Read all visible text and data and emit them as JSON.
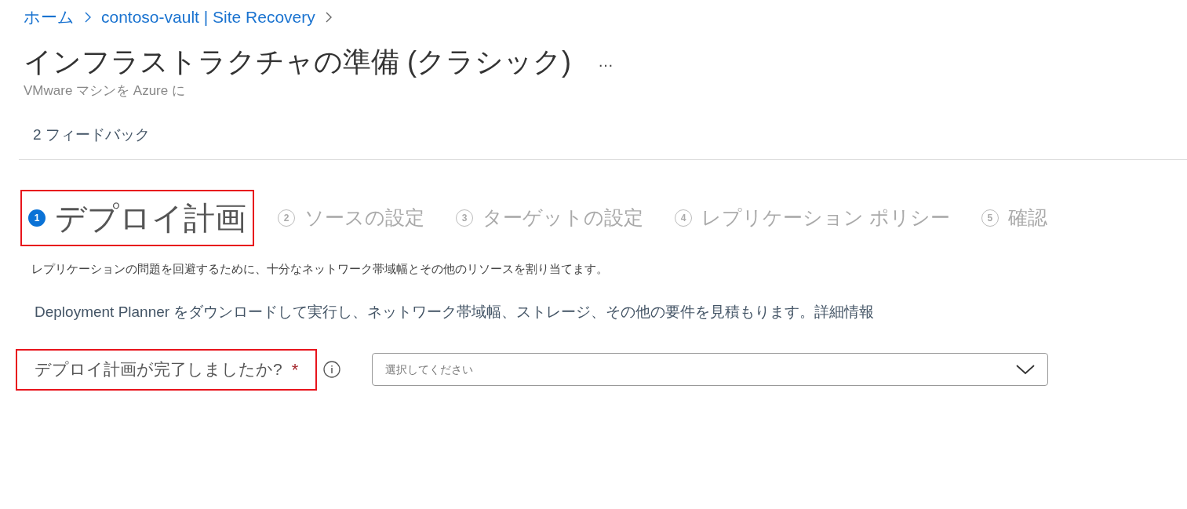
{
  "breadcrumb": [
    "ホーム",
    "contoso-vault | Site Recovery"
  ],
  "title": "インフラストラクチャの準備 (クラシック)",
  "more": "…",
  "subtitle": "VMware マシンを Azure に",
  "toolbar": {
    "feedback": "2 フィードバック"
  },
  "steps": [
    {
      "number": "1",
      "label": "デプロイ計画",
      "selected": true,
      "highlighted": true
    },
    {
      "number": "2",
      "label": "ソースの設定",
      "selected": false,
      "highlighted": false
    },
    {
      "number": "3",
      "label": "ターゲットの設定",
      "selected": false,
      "highlighted": false
    },
    {
      "number": "4",
      "label": "レプリケーション ポリシー",
      "selected": false,
      "highlighted": false
    },
    {
      "number": "5",
      "label": "確認",
      "selected": false,
      "highlighted": false
    }
  ],
  "description": "レプリケーションの問題を回避するために、十分なネットワーク帯域幅とその他のリソースを割り当てます。",
  "planner_text": "Deployment  Planner をダウンロードして実行し、ネットワーク帯域幅、ストレージ、その他の要件を見積もります。",
  "planner_link": "詳細情報",
  "question": {
    "label": "デプロイ計画が完了しましたか?",
    "required": "*",
    "highlighted": true,
    "placeholder": "選択してください"
  }
}
